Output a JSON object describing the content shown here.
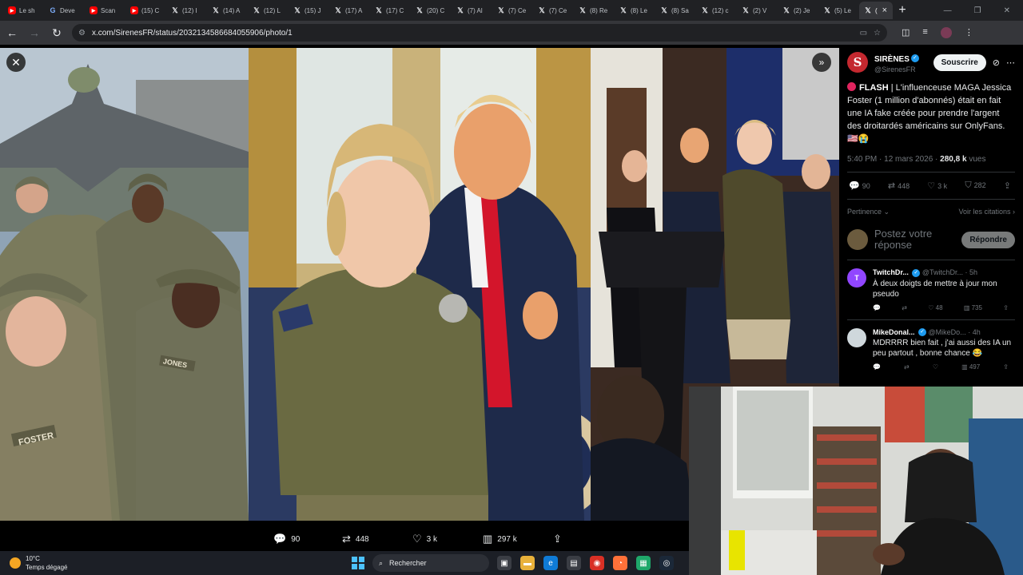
{
  "browser": {
    "tabs": [
      {
        "icon": "youtube-icon",
        "label": "Le sh"
      },
      {
        "icon": "google-icon",
        "label": "Deve"
      },
      {
        "icon": "youtube-icon",
        "label": "Scan"
      },
      {
        "icon": "youtube-icon",
        "label": "(15) C"
      },
      {
        "icon": "x-icon",
        "label": "(12) I"
      },
      {
        "icon": "x-icon",
        "label": "(14) A"
      },
      {
        "icon": "x-icon",
        "label": "(12) L"
      },
      {
        "icon": "x-icon",
        "label": "(15) J"
      },
      {
        "icon": "x-icon",
        "label": "(17) A"
      },
      {
        "icon": "x-icon",
        "label": "(17) C"
      },
      {
        "icon": "x-icon",
        "label": "(20) C"
      },
      {
        "icon": "x-icon",
        "label": "(7) Al"
      },
      {
        "icon": "x-icon",
        "label": "(7) Ce"
      },
      {
        "icon": "x-icon",
        "label": "(7) Ce"
      },
      {
        "icon": "x-icon",
        "label": "(8) Re"
      },
      {
        "icon": "x-icon",
        "label": "(8) Le"
      },
      {
        "icon": "x-icon",
        "label": "(8) Sa"
      },
      {
        "icon": "x-icon",
        "label": "(12) c"
      },
      {
        "icon": "x-icon",
        "label": "(2) V"
      },
      {
        "icon": "x-icon",
        "label": "(2) Je"
      },
      {
        "icon": "x-icon",
        "label": "(5) Le"
      }
    ],
    "active_tab_label": "(",
    "url": "x.com/SirenesFR/status/2032134586684055906/photo/1"
  },
  "post": {
    "author_name": "SIRÈNES",
    "author_initial": "S",
    "handle": "@SirenesFR",
    "subscribe_label": "Souscrire",
    "text_flash": "FLASH",
    "text_body": "| L'influenceuse MAGA Jessica Foster (1 million d'abonnés) était en fait une IA fake créée pour prendre l'argent des droitardés américains sur OnlyFans. 🇺🇸😭",
    "time": "5:40 PM · 12 mars 2026 ·",
    "views": "280,8 k",
    "views_label": "vues",
    "replies": "90",
    "reposts": "448",
    "likes": "3 k",
    "bookmarks": "282",
    "sort_label": "Pertinence",
    "quotes_link": "Voir les citations",
    "reply_placeholder": "Postez votre réponse",
    "reply_button": "Répondre"
  },
  "replies": [
    {
      "name": "TwitchDr...",
      "handle": "@TwitchDr...",
      "time": "· 5h",
      "text": "À deux doigts de mettre à jour mon pseudo",
      "likes": "48",
      "views": "735"
    },
    {
      "name": "MikeDonal...",
      "handle": "@MikeDo...",
      "time": "· 4h",
      "text": "MDRRRR bien fait , j'ai aussi des IA un peu partout , bonne chance 😂",
      "likes": "",
      "views": "497"
    }
  ],
  "photo_bar": {
    "replies": "90",
    "reposts": "448",
    "likes": "3 k",
    "views": "297 k"
  },
  "taskbar": {
    "temp": "10°C",
    "weather": "Temps dégagé",
    "search": "Rechercher"
  },
  "photo_text": {
    "name_tape_left": "FOSTER",
    "name_tape_right": "JONES"
  },
  "colors": {
    "accent": "#1d9bf0",
    "background": "#000000",
    "author_avatar": "#c4282f",
    "flash_dot": "#e0245e"
  }
}
